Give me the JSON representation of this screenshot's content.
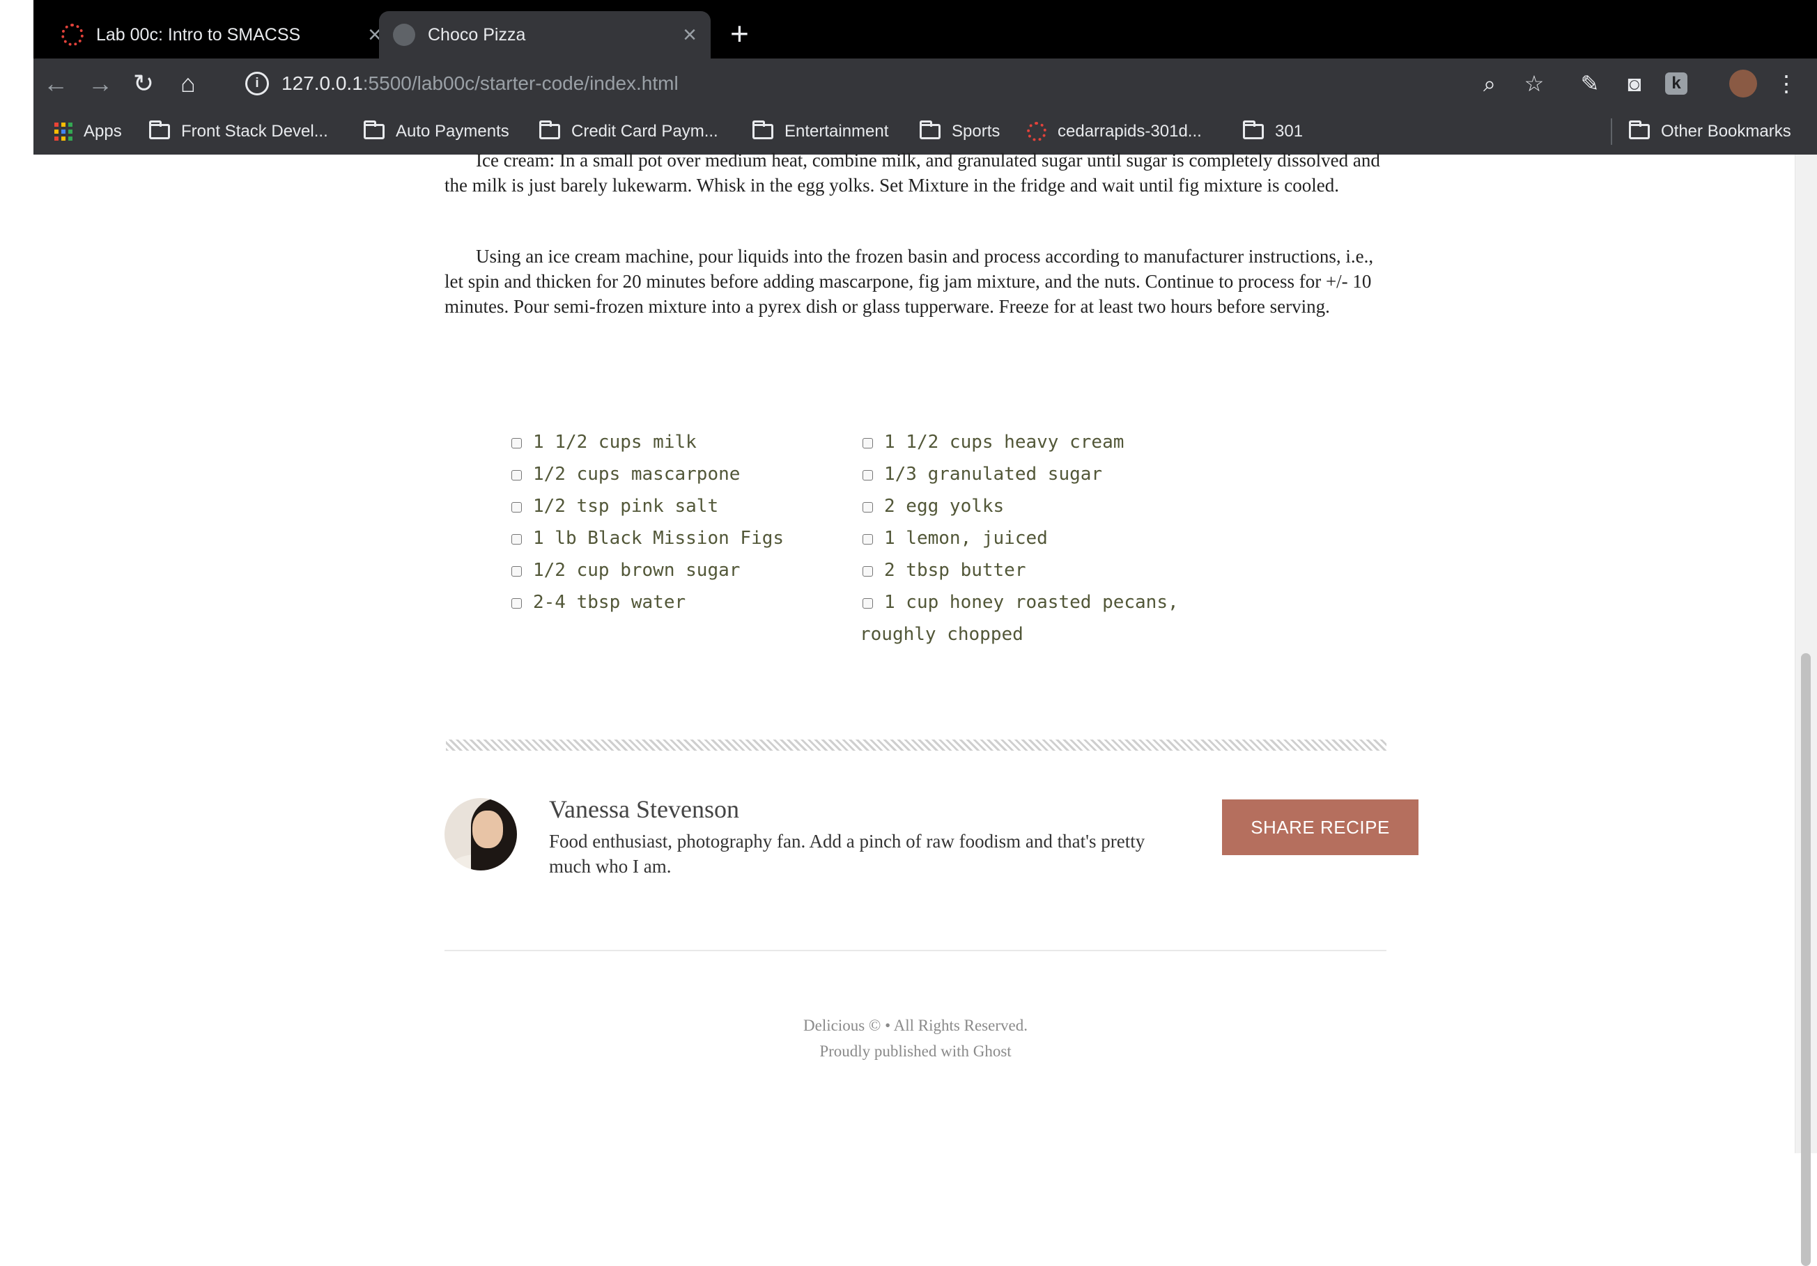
{
  "browser": {
    "tabs": [
      {
        "title": "Lab 00c: Intro to SMACSS",
        "active": false,
        "favicon": "canvas-icon"
      },
      {
        "title": "Choco Pizza",
        "active": true,
        "favicon": "globe-icon"
      }
    ],
    "address": {
      "host": "127.0.0.1",
      "path": ":5500/lab00c/starter-code/index.html"
    },
    "bookmarks": [
      {
        "label": "Apps",
        "icon": "apps-grid-icon"
      },
      {
        "label": "Front Stack Devel...",
        "icon": "folder-icon"
      },
      {
        "label": "Auto Payments",
        "icon": "folder-icon"
      },
      {
        "label": "Credit Card Paym...",
        "icon": "folder-icon"
      },
      {
        "label": "Entertainment",
        "icon": "folder-icon"
      },
      {
        "label": "Sports",
        "icon": "folder-icon"
      },
      {
        "label": "cedarrapids-301d...",
        "icon": "canvas-icon"
      },
      {
        "label": "301",
        "icon": "folder-icon"
      }
    ],
    "other_bookmarks": "Other Bookmarks"
  },
  "recipe": {
    "paragraphs": [
      "Ice cream: In a small pot over medium heat, combine milk, and granulated sugar until sugar is completely dissolved and the milk is just barely lukewarm. Whisk in the egg yolks. Set Mixture in the fridge and wait until fig mixture is cooled.",
      "Using an ice cream machine, pour liquids into the frozen basin and process according to manufacturer instructions, i.e., let spin and thicken for 20 minutes before adding mascarpone, fig jam mixture, and the nuts. Continue to process for +/- 10 minutes. Pour semi-frozen mixture into a pyrex dish or glass tupperware. Freeze for at least two hours before serving."
    ],
    "ingredients_left": [
      "1 1/2 cups milk",
      "1/2 cups mascarpone",
      "1/2 tsp pink salt",
      "1 lb Black Mission Figs",
      "1/2 cup brown sugar",
      "2-4 tbsp water"
    ],
    "ingredients_right": [
      "1 1/2 cups heavy cream",
      "1/3 granulated sugar",
      "2 egg yolks",
      "1 lemon, juiced",
      "2 tbsp butter",
      "1 cup honey roasted pecans, roughly chopped"
    ]
  },
  "author": {
    "name": "Vanessa Stevenson",
    "bio": "Food enthusiast, photography fan. Add a pinch of raw foodism and that's pretty much who I am.",
    "share_label": "SHARE RECIPE"
  },
  "footer": {
    "line1": "Delicious © • All Rights Reserved.",
    "line2": "Proudly published with Ghost"
  },
  "colors": {
    "accent": "#b56f5e",
    "ingredient_text": "#525738"
  }
}
